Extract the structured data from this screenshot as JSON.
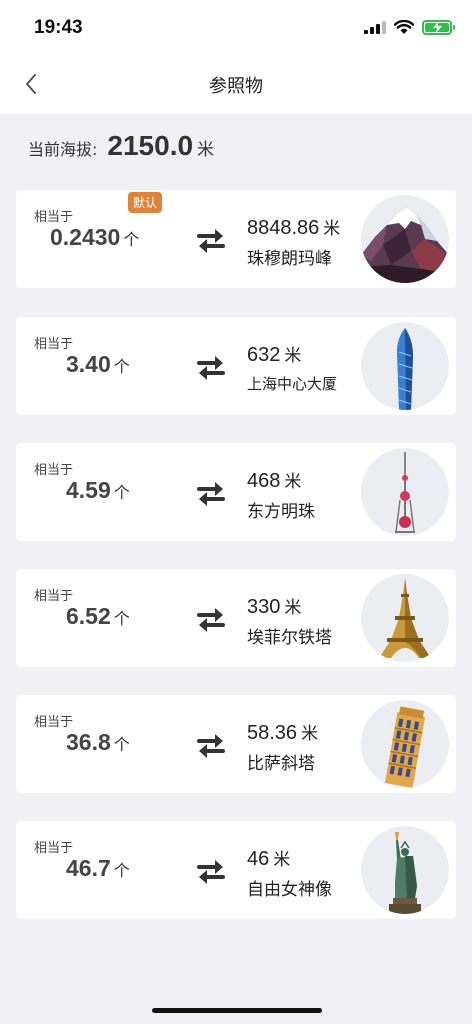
{
  "status_bar": {
    "time": "19:43"
  },
  "nav": {
    "title": "参照物",
    "back_icon": "chevron-left-icon"
  },
  "altitude": {
    "label": "当前海拔:",
    "value": "2150.0",
    "unit": "米"
  },
  "eq_label": "相当于",
  "count_unit": "个",
  "default_badge": "默认",
  "references": [
    {
      "count": "0.2430",
      "height": "8848.86",
      "unit": "米",
      "name": "珠穆朗玛峰",
      "icon": "mountain-icon",
      "default": true
    },
    {
      "count": "3.40",
      "height": "632",
      "unit": "米",
      "name": "上海中心大厦",
      "icon": "skyscraper-icon"
    },
    {
      "count": "4.59",
      "height": "468",
      "unit": "米",
      "name": "东方明珠",
      "icon": "tv-tower-icon"
    },
    {
      "count": "6.52",
      "height": "330",
      "unit": "米",
      "name": "埃菲尔铁塔",
      "icon": "eiffel-tower-icon"
    },
    {
      "count": "36.8",
      "height": "58.36",
      "unit": "米",
      "name": "比萨斜塔",
      "icon": "leaning-tower-icon"
    },
    {
      "count": "46.7",
      "height": "46",
      "unit": "米",
      "name": "自由女神像",
      "icon": "statue-of-liberty-icon"
    }
  ],
  "colors": {
    "background": "#f1f1f5",
    "badge": "#e0833a",
    "battery": "#2fbf4a"
  }
}
